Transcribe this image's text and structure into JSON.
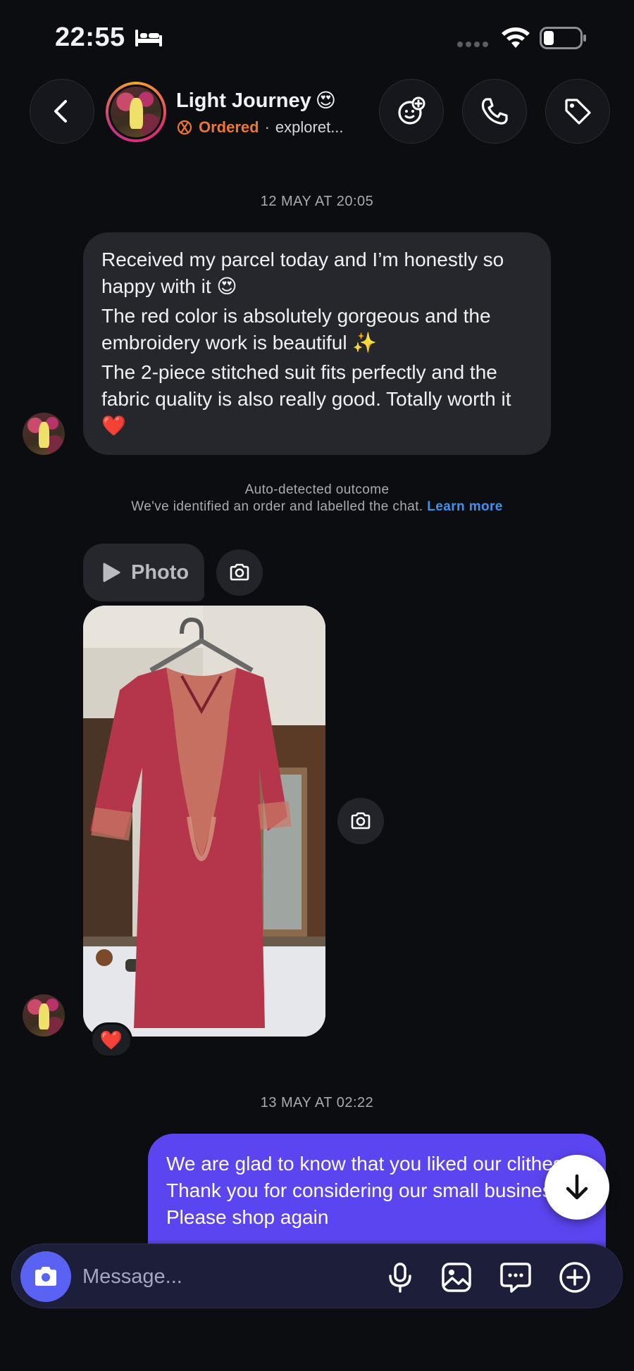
{
  "status_bar": {
    "time": "22:55",
    "icons": [
      "bed-icon",
      "signal-icon",
      "wifi-icon",
      "battery-icon"
    ]
  },
  "header": {
    "contact_name": "Light Journey",
    "contact_emoji": "😍",
    "order_status": "Ordered",
    "separator": "·",
    "handle": "exploret...",
    "buttons": [
      "back-icon",
      "effects-icon",
      "phone-icon",
      "tag-icon"
    ]
  },
  "conversation": {
    "timestamp_1": "12 MAY AT 20:05",
    "incoming_message": {
      "line_1": "Received my parcel today and I’m honestly so happy with it 😍",
      "line_2": "The red color is absolutely gorgeous and the embroidery work is beautiful ✨",
      "line_3": "The 2-piece stitched suit fits perfectly and the fabric quality is also really good. Totally worth it ❤️"
    },
    "auto_detect": {
      "title": "Auto-detected outcome",
      "body": "We've identified an order and labelled the chat.",
      "link": "Learn more"
    },
    "photo_chip_label": "Photo",
    "photo_reaction": "❤️",
    "timestamp_2": "13 MAY AT 02:22",
    "outgoing_message": {
      "line_1": "We are glad to know that you liked our clithes. Thank you for considering our small business💞",
      "line_2": "Please shop again"
    }
  },
  "composer": {
    "placeholder": "Message...",
    "icons": [
      "camera-icon",
      "microphone-icon",
      "gallery-icon",
      "sticker-icon",
      "plus-icon"
    ]
  },
  "colors": {
    "background": "#0c0d11",
    "incoming_bubble": "#25272d",
    "outgoing_bubble": "#5b45f0",
    "ordered_accent": "#f0762e",
    "link": "#3d93f0",
    "composer_camera": "#5a62f4"
  }
}
